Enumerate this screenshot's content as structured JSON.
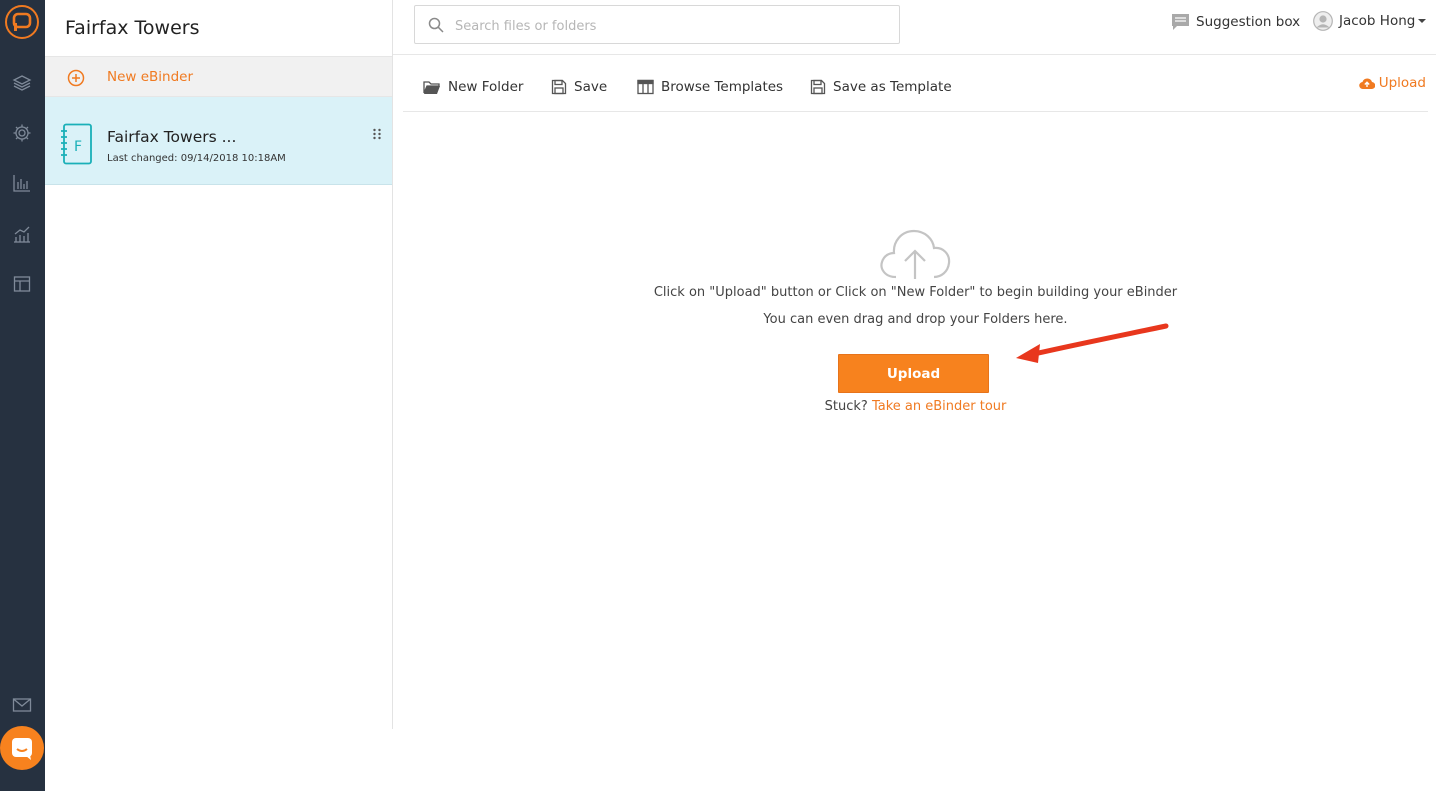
{
  "rail": {
    "logo_icon": "app-logo-icon",
    "items": [
      {
        "icon": "layers-icon"
      },
      {
        "icon": "gear-icon"
      },
      {
        "icon": "bar-chart-icon"
      },
      {
        "icon": "growth-chart-icon"
      },
      {
        "icon": "template-icon"
      }
    ],
    "mail_icon": "mail-icon",
    "chat_icon": "chat-icon"
  },
  "panel": {
    "title": "Fairfax Towers",
    "new_ebinder_label": "New eBinder",
    "binders": [
      {
        "name": "Fairfax Towers ...",
        "last_changed": "Last changed: 09/14/2018 10:18AM",
        "initial": "F"
      }
    ]
  },
  "topbar": {
    "search_placeholder": "Search files or folders",
    "suggestion_label": "Suggestion box",
    "user_name": "Jacob Hong"
  },
  "toolbar": {
    "new_folder": "New Folder",
    "save": "Save",
    "browse_templates": "Browse Templates",
    "save_as_template": "Save as Template",
    "upload": "Upload"
  },
  "empty_state": {
    "line1": "Click on \"Upload\" button or Click on \"New Folder\" to begin building your eBinder",
    "line2": "You can even drag and drop your Folders here.",
    "upload_button": "Upload",
    "stuck_prefix": "Stuck?",
    "tour_link": "Take an eBinder tour"
  },
  "colors": {
    "accent": "#f07a21",
    "button": "#f7821e",
    "rail": "#263140",
    "selected_row": "#daf2f8",
    "teal": "#1ab0b8",
    "annotation_arrow": "#e8371d"
  }
}
